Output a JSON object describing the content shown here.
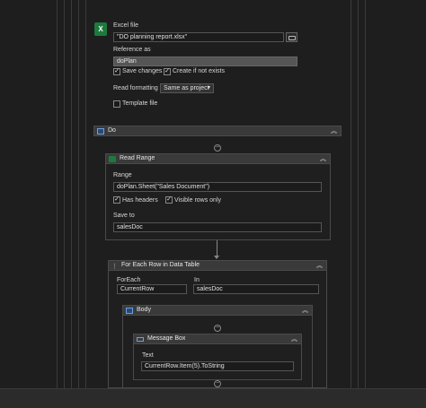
{
  "excel": {
    "title": "Excel file",
    "file_value": "\"DO planning report.xlsx\"",
    "reference_label": "Reference as",
    "reference_value": "doPlan",
    "save_changes": "Save changes",
    "create_if_not_exists": "Create if not exists",
    "read_formatting_label": "Read formatting",
    "read_formatting_value": "Same as project",
    "template_file": "Template file"
  },
  "do": {
    "title": "Do"
  },
  "read_range": {
    "title": "Read Range",
    "range_label": "Range",
    "range_value": "doPlan.Sheet(\"Sales Document\")",
    "has_headers": "Has headers",
    "visible_rows_only": "Visible rows only",
    "save_to_label": "Save to",
    "save_to_value": "salesDoc"
  },
  "for_each": {
    "title": "For Each Row in Data Table",
    "foreach_label": "ForEach",
    "foreach_value": "CurrentRow",
    "in_label": "In",
    "in_value": "salesDoc"
  },
  "body": {
    "title": "Body"
  },
  "message_box": {
    "title": "Message Box",
    "text_label": "Text",
    "text_value": "CurrentRow.Item(5).ToString"
  },
  "colors": {
    "excel_green": "#1d7a3e",
    "panel": "#3a3a3a",
    "background": "#1e1e1e"
  }
}
